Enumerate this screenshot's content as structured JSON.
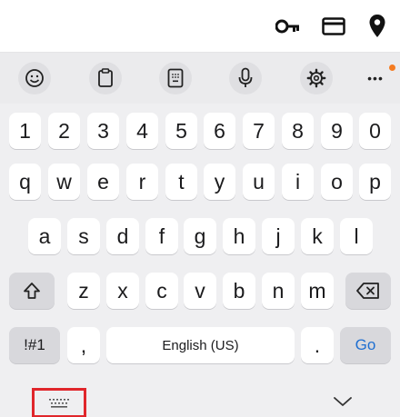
{
  "autofill_bar": {
    "icons": [
      "key-icon",
      "credit-card-icon",
      "location-pin-icon"
    ]
  },
  "toolbar": {
    "buttons": [
      "emoji-icon",
      "clipboard-icon",
      "one-handed-keyboard-icon",
      "microphone-icon",
      "settings-icon"
    ],
    "more_label": "•••",
    "notification_color": "#f47b20"
  },
  "keyboard": {
    "row_numbers": [
      "1",
      "2",
      "3",
      "4",
      "5",
      "6",
      "7",
      "8",
      "9",
      "0"
    ],
    "row_top": [
      "q",
      "w",
      "e",
      "r",
      "t",
      "y",
      "u",
      "i",
      "o",
      "p"
    ],
    "row_middle": [
      "a",
      "s",
      "d",
      "f",
      "g",
      "h",
      "j",
      "k",
      "l"
    ],
    "row_bottom": [
      "z",
      "x",
      "c",
      "v",
      "b",
      "n",
      "m"
    ],
    "symbols_label": "!#1",
    "comma_label": ",",
    "space_label": "English (US)",
    "period_label": ".",
    "go_label": "Go",
    "go_color": "#1f6fd1"
  },
  "bottom_bar": {
    "highlight_color": "#e0262b"
  }
}
